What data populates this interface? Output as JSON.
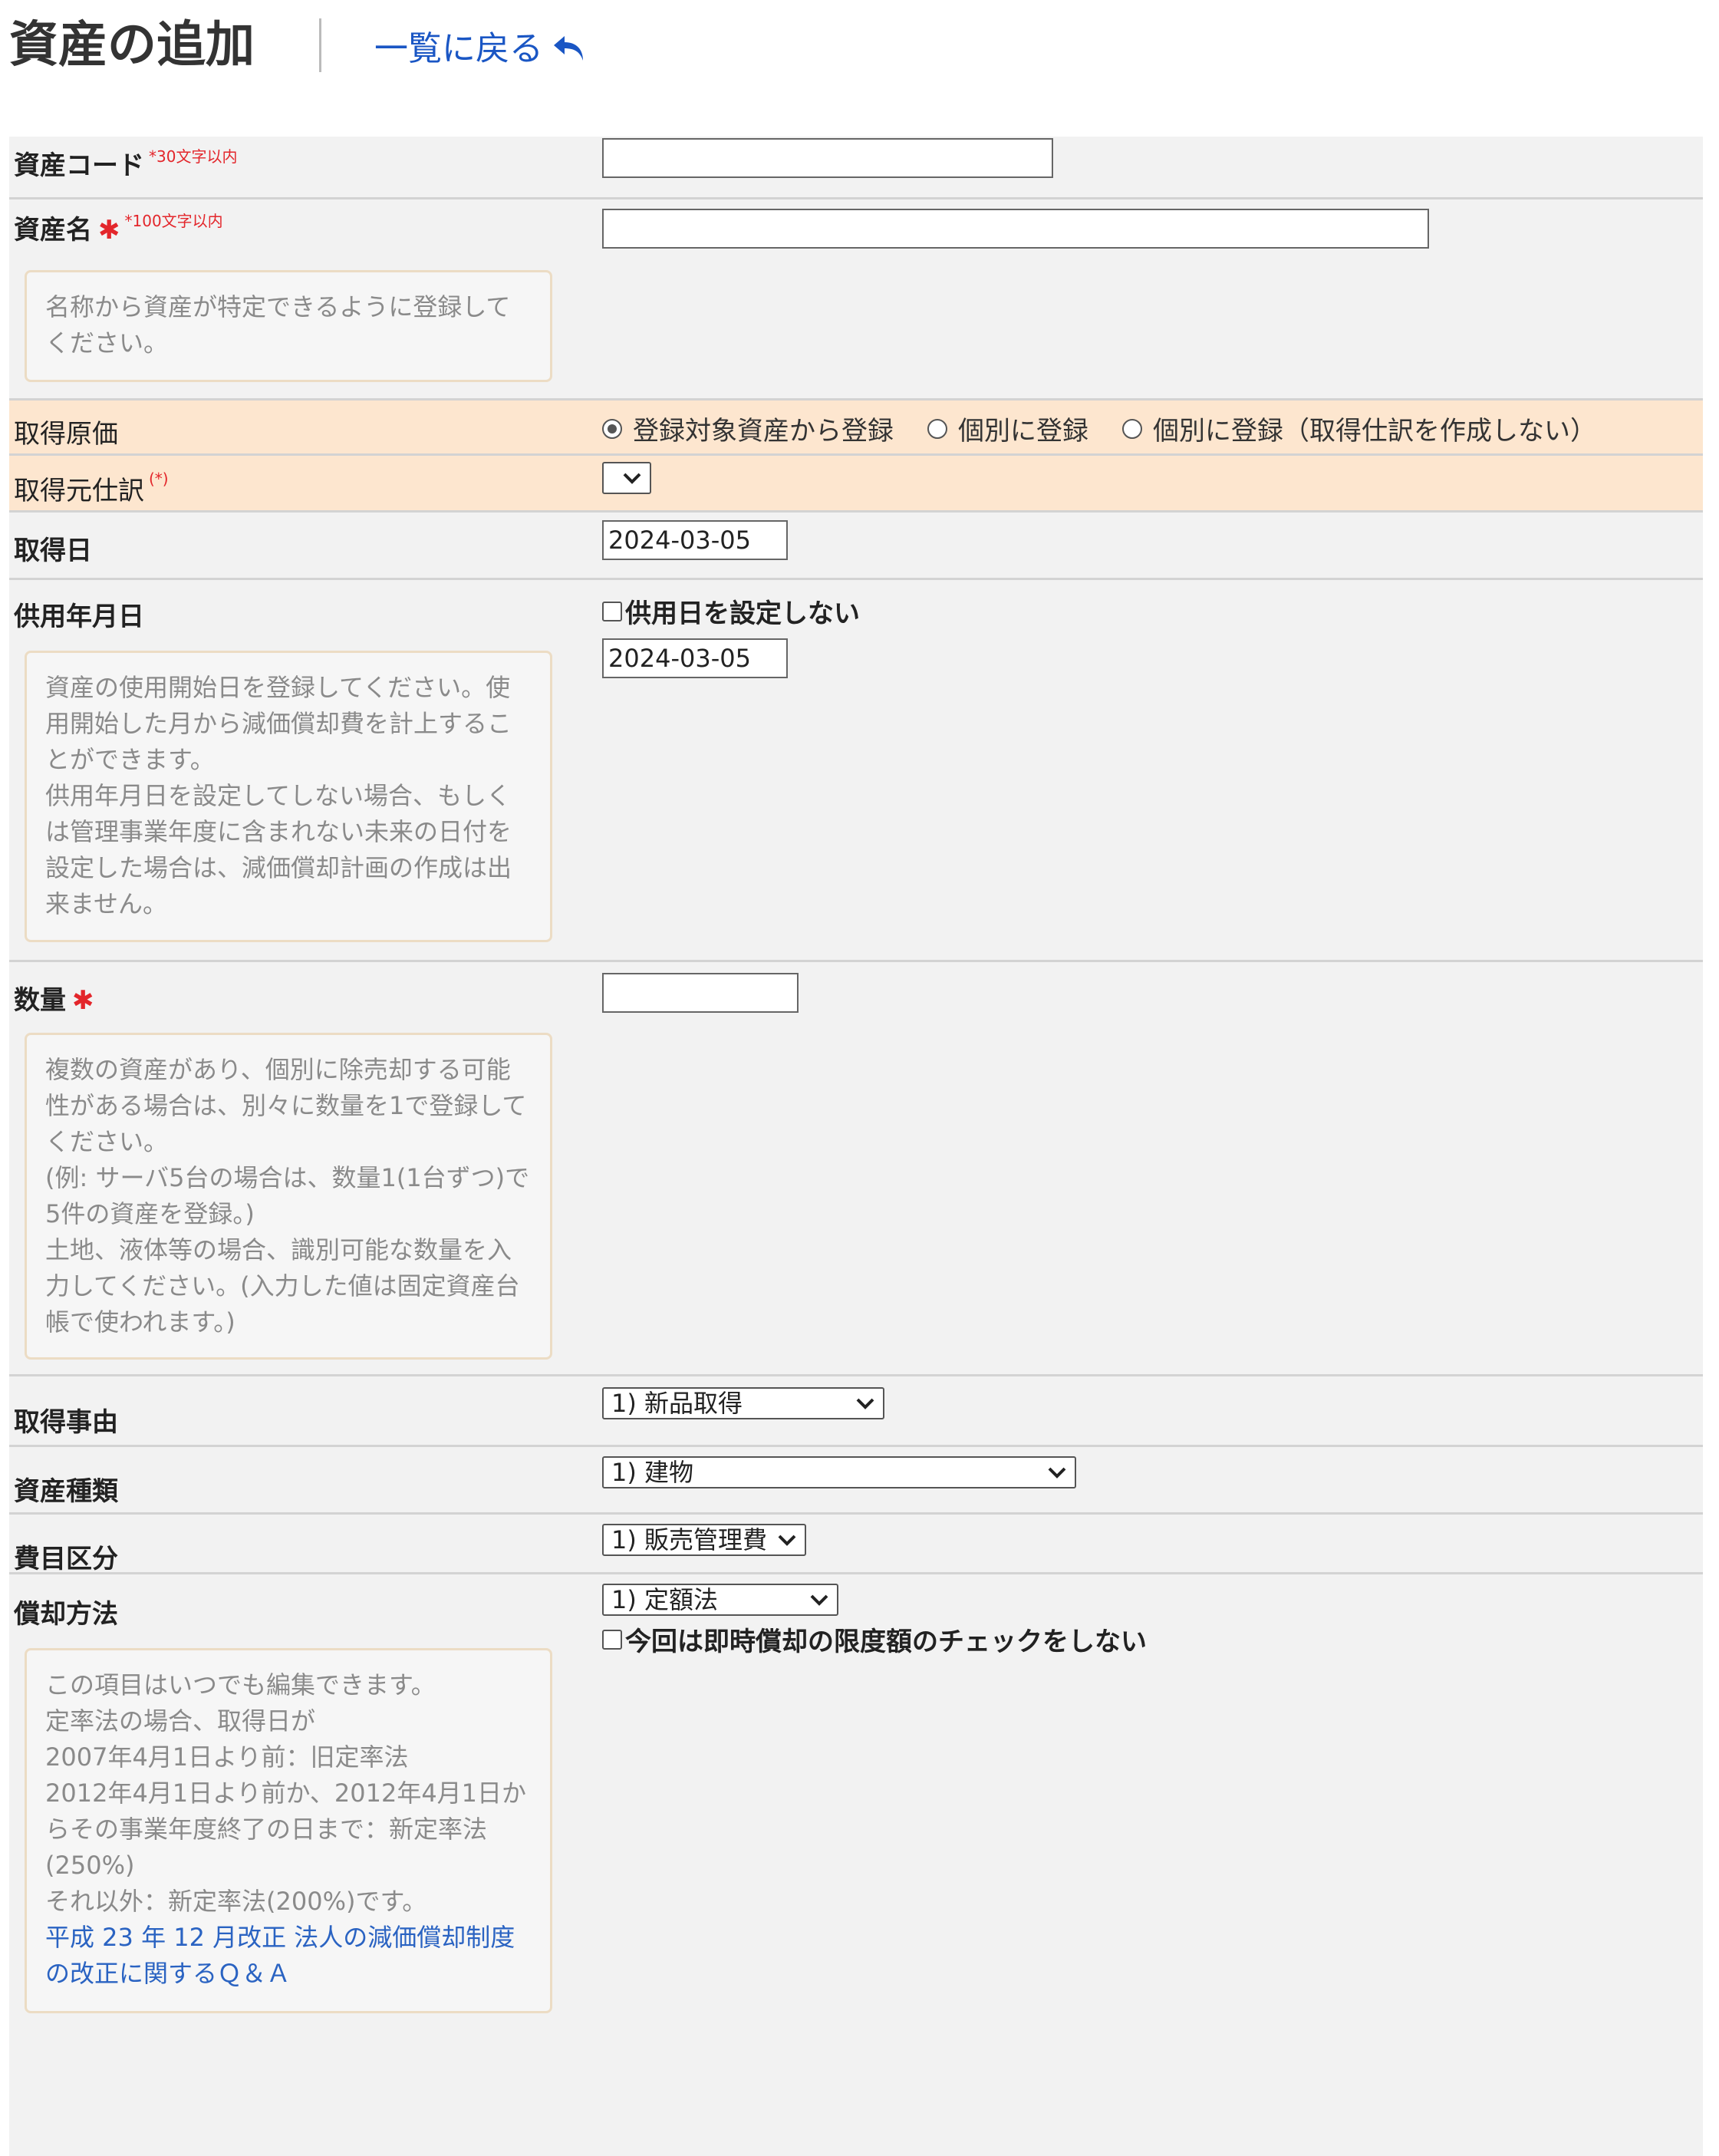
{
  "header": {
    "title": "資産の追加",
    "back_link": "一覧に戻る"
  },
  "fields": {
    "asset_code": {
      "label": "資産コード",
      "note": "*30文字以内",
      "value": ""
    },
    "asset_name": {
      "label": "資産名",
      "required_mark": "✱",
      "note": "*100文字以内",
      "value": "",
      "hint": "名称から資産が特定できるように登録してください。"
    },
    "acquisition_cost": {
      "label": "取得原価",
      "options": [
        "登録対象資産から登録",
        "個別に登録",
        "個別に登録（取得仕訳を作成しない）"
      ],
      "selected_index": 0
    },
    "source_journal": {
      "label": "取得元仕訳",
      "note": "(*)",
      "value": ""
    },
    "acquisition_date": {
      "label": "取得日",
      "value": "2024-03-05"
    },
    "service_date": {
      "label": "供用年月日",
      "checkbox_label": "供用日を設定しない",
      "value": "2024-03-05",
      "hint": [
        "資産の使用開始日を登録してください。使用開始した月から減価償却費を計上することができます。",
        "供用年月日を設定してしない場合、もしくは管理事業年度に含まれない未来の日付を設定した場合は、減価償却計画の作成は出来ません。"
      ]
    },
    "quantity": {
      "label": "数量",
      "required_mark": "✱",
      "value": "",
      "hint": [
        "複数の資産があり、個別に除売却する可能性がある場合は、別々に数量を1で登録してください。",
        "(例: サーバ5台の場合は、数量1(1台ずつ)で5件の資産を登録。)",
        "土地、液体等の場合、識別可能な数量を入力してください。(入力した値は固定資産台帳で使われます。)"
      ]
    },
    "acquisition_reason": {
      "label": "取得事由",
      "value": "1) 新品取得"
    },
    "asset_type": {
      "label": "資産種類",
      "value": "1) 建物"
    },
    "expense_category": {
      "label": "費目区分",
      "value": "1) 販売管理費"
    },
    "depreciation_method": {
      "label": "償却方法",
      "value": "1) 定額法",
      "checkbox_label": "今回は即時償却の限度額のチェックをしない",
      "hint": [
        "この項目はいつでも編集できます。",
        "定率法の場合、取得日が",
        "2007年4月1日より前：旧定率法",
        "2012年4月1日より前か、2012年4月1日からその事業年度終了の日まで：新定率法(250%)",
        "それ以外：新定率法(200%)です。"
      ],
      "hint_link": "平成 23 年 12 月改正 法人の減価償却制度の改正に関するＱ＆Ａ"
    }
  }
}
